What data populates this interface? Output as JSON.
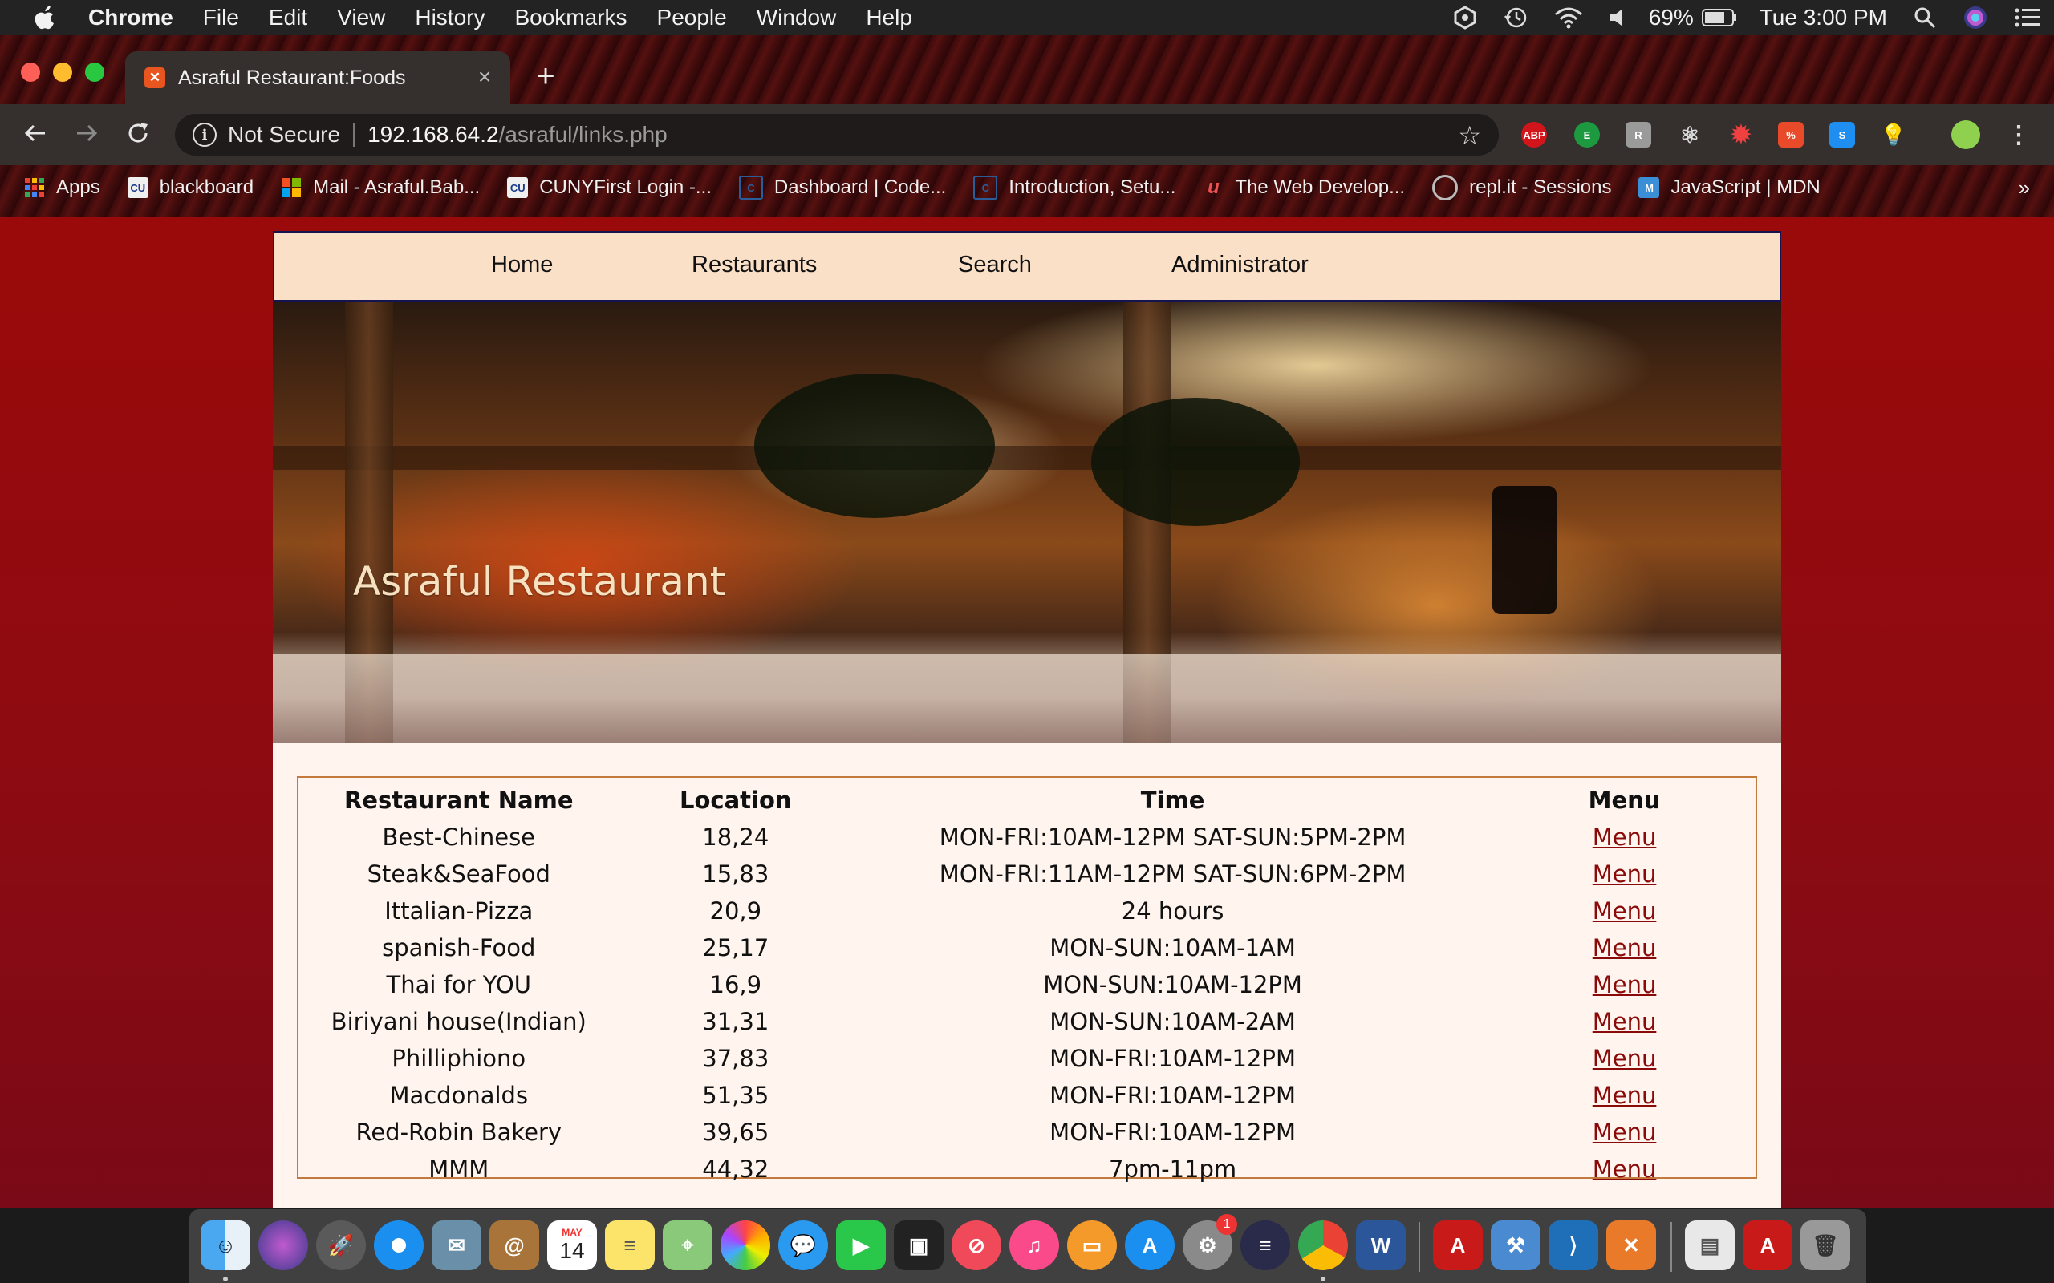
{
  "menubar": {
    "app_name": "Chrome",
    "items": [
      "File",
      "Edit",
      "View",
      "History",
      "Bookmarks",
      "People",
      "Window",
      "Help"
    ],
    "battery": "69%",
    "clock": "Tue 3:00 PM"
  },
  "browser": {
    "tab_title": "Asraful Restaurant:Foods",
    "security_label": "Not Secure",
    "url_host": "192.168.64.2",
    "url_path": "/asraful/links.php",
    "bookmarks": [
      "Apps",
      "blackboard",
      "Mail - Asraful.Bab...",
      "CUNYFirst Login -...",
      "Dashboard | Code...",
      "Introduction, Setu...",
      "The Web Develop...",
      "repl.it - Sessions",
      "JavaScript | MDN"
    ],
    "bookmarks_overflow": "»"
  },
  "site": {
    "nav": [
      "Home",
      "Restaurants",
      "Search",
      "Administrator"
    ],
    "hero_title": "Asraful Restaurant",
    "table": {
      "headers": [
        "Restaurant Name",
        "Location",
        "Time",
        "Menu"
      ],
      "rows": [
        [
          "Best-Chinese",
          "18,24",
          "MON-FRI:10AM-12PM SAT-SUN:5PM-2PM",
          "Menu"
        ],
        [
          "Steak&SeaFood",
          "15,83",
          "MON-FRI:11AM-12PM SAT-SUN:6PM-2PM",
          "Menu"
        ],
        [
          "Ittalian-Pizza",
          "20,9",
          "24 hours",
          "Menu"
        ],
        [
          "spanish-Food",
          "25,17",
          "MON-SUN:10AM-1AM",
          "Menu"
        ],
        [
          "Thai for YOU",
          "16,9",
          "MON-SUN:10AM-12PM",
          "Menu"
        ],
        [
          "Biriyani house(Indian)",
          "31,31",
          "MON-SUN:10AM-2AM",
          "Menu"
        ],
        [
          "Philliphiono",
          "37,83",
          "MON-FRI:10AM-12PM",
          "Menu"
        ],
        [
          "Macdonalds",
          "51,35",
          "MON-FRI:10AM-12PM",
          "Menu"
        ],
        [
          "Red-Robin Bakery",
          "39,65",
          "MON-FRI:10AM-12PM",
          "Menu"
        ],
        [
          "MMM",
          "44,32",
          "7pm-11pm",
          "Menu"
        ]
      ]
    }
  },
  "dock": {
    "calendar_month": "MAY",
    "calendar_day": "14",
    "notification_badge": "1"
  },
  "colors": {
    "page_bg": "#9b0a0a",
    "nav_bg": "#fbe0c8",
    "content_bg": "#fff4ee",
    "link": "#8a0a0a",
    "table_border": "#c47a3c"
  }
}
